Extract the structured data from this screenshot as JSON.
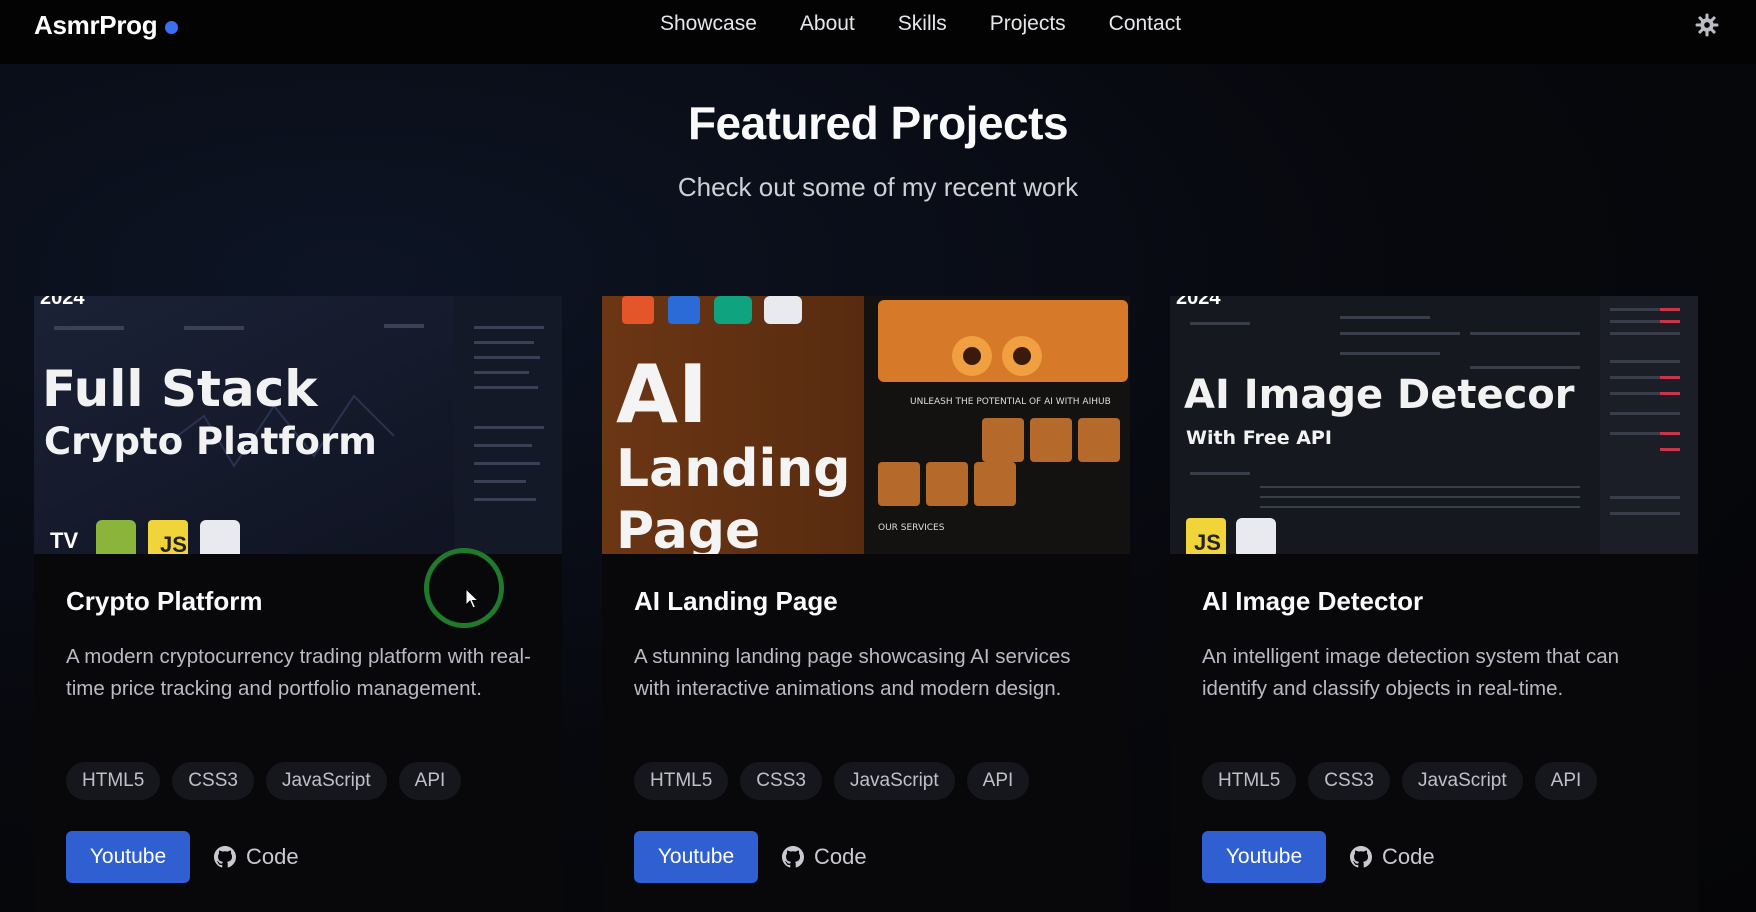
{
  "nav": {
    "brand": "AsmrProg",
    "links": [
      "Showcase",
      "About",
      "Skills",
      "Projects",
      "Contact"
    ],
    "theme_icon": "gear-icon"
  },
  "hero": {
    "title": "Featured Projects",
    "subtitle": "Check out some of my recent work"
  },
  "projects": [
    {
      "thumb": {
        "year": "2024",
        "line1": "Full Stack",
        "line2": "Crypto Platform"
      },
      "title": "Crypto Platform",
      "description": "A modern cryptocurrency trading platform with real-time price tracking and portfolio management.",
      "tags": [
        "HTML5",
        "CSS3",
        "JavaScript",
        "API"
      ],
      "youtube_label": "Youtube",
      "code_label": "Code"
    },
    {
      "thumb": {
        "line1": "AI",
        "line2": "Landing",
        "line3": "Page",
        "tagline": "UNLEASH THE POTENTIAL OF AI WITH AIHUB",
        "services": "OUR SERVICES"
      },
      "title": "AI Landing Page",
      "description": "A stunning landing page showcasing AI services with interactive animations and modern design.",
      "tags": [
        "HTML5",
        "CSS3",
        "JavaScript",
        "API"
      ],
      "youtube_label": "Youtube",
      "code_label": "Code"
    },
    {
      "thumb": {
        "year": "2024",
        "line1": "AI Image Detecor",
        "line2": "With Free API"
      },
      "title": "AI Image Detector",
      "description": "An intelligent image detection system that can identify and classify objects in real-time.",
      "tags": [
        "HTML5",
        "CSS3",
        "JavaScript",
        "API"
      ],
      "youtube_label": "Youtube",
      "code_label": "Code"
    }
  ],
  "colors": {
    "accent": "#2f5fd0",
    "brand_dot": "#3b6ef0",
    "background": "#07080d"
  }
}
